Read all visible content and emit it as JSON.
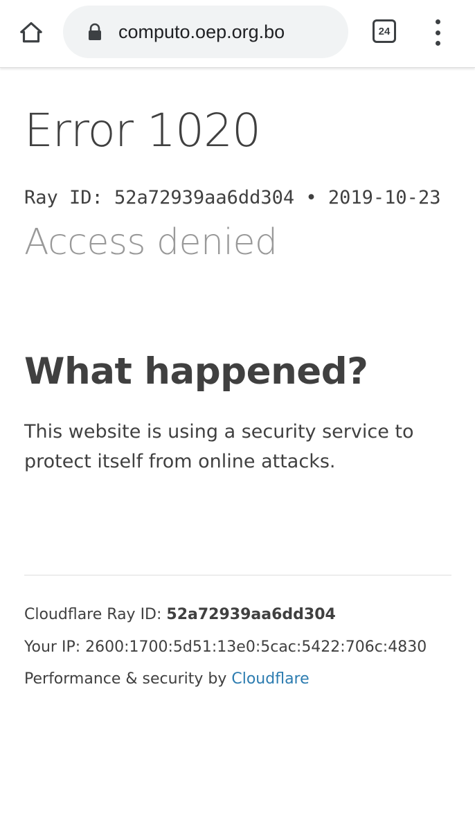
{
  "browser": {
    "url": "computo.oep.org.bo",
    "tab_count": "24",
    "icons": {
      "home": "home-icon",
      "lock": "lock-icon",
      "menu": "more-vert-icon"
    }
  },
  "page": {
    "error_title": "Error 1020",
    "ray_line": "Ray ID: 52a72939aa6dd304 • 2019-10-23",
    "access_denied": "Access denied",
    "heading": "What happened?",
    "explanation": "This website is using a security service to protect itself from online attacks.",
    "footer": {
      "ray_label": "Cloudflare Ray ID: ",
      "ray_id": "52a72939aa6dd304",
      "ip_label": "Your IP: ",
      "ip_value": "2600:1700:5d51:13e0:5cac:5422:706c:4830",
      "perf_label": "Performance & security by ",
      "perf_link": "Cloudflare"
    }
  },
  "colors": {
    "link": "#2c7cb0",
    "muted": "#999999",
    "text": "#404040"
  }
}
